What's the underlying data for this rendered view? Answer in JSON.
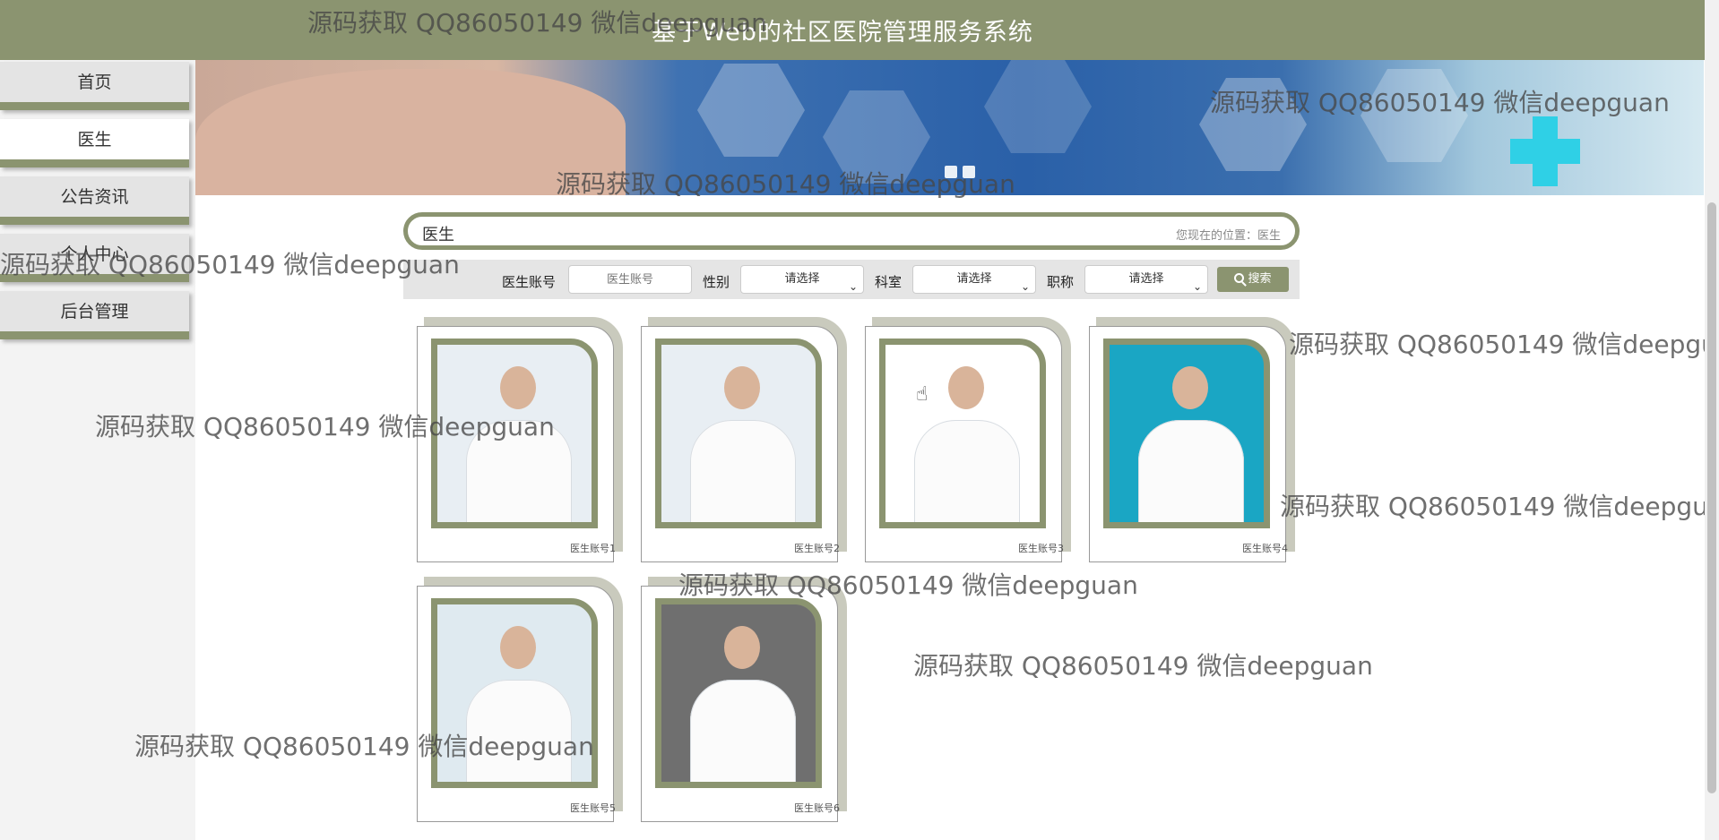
{
  "header": {
    "title": "基于Web的社区医院管理服务系统"
  },
  "sidebar": {
    "items": [
      {
        "label": "首页"
      },
      {
        "label": "医生"
      },
      {
        "label": "公告资讯"
      },
      {
        "label": "个人中心"
      },
      {
        "label": "后台管理"
      }
    ],
    "active": "医生"
  },
  "breadcrumb": {
    "title": "医生",
    "location": "您现在的位置：医生"
  },
  "search": {
    "account_label": "医生账号",
    "account_placeholder": "医生账号",
    "gender_label": "性别",
    "gender_value": "请选择",
    "dept_label": "科室",
    "dept_value": "请选择",
    "title_label": "职称",
    "title_value": "请选择",
    "button_label": "搜索"
  },
  "doctors": [
    {
      "caption": "医生账号1"
    },
    {
      "caption": "医生账号2"
    },
    {
      "caption": "医生账号3"
    },
    {
      "caption": "医生账号4"
    },
    {
      "caption": "医生账号5"
    },
    {
      "caption": "医生账号6"
    }
  ],
  "watermark": "源码获取 QQ86050149 微信deepguan",
  "colors": {
    "brand": "#8b9470",
    "card_back": "#c9cabd"
  }
}
